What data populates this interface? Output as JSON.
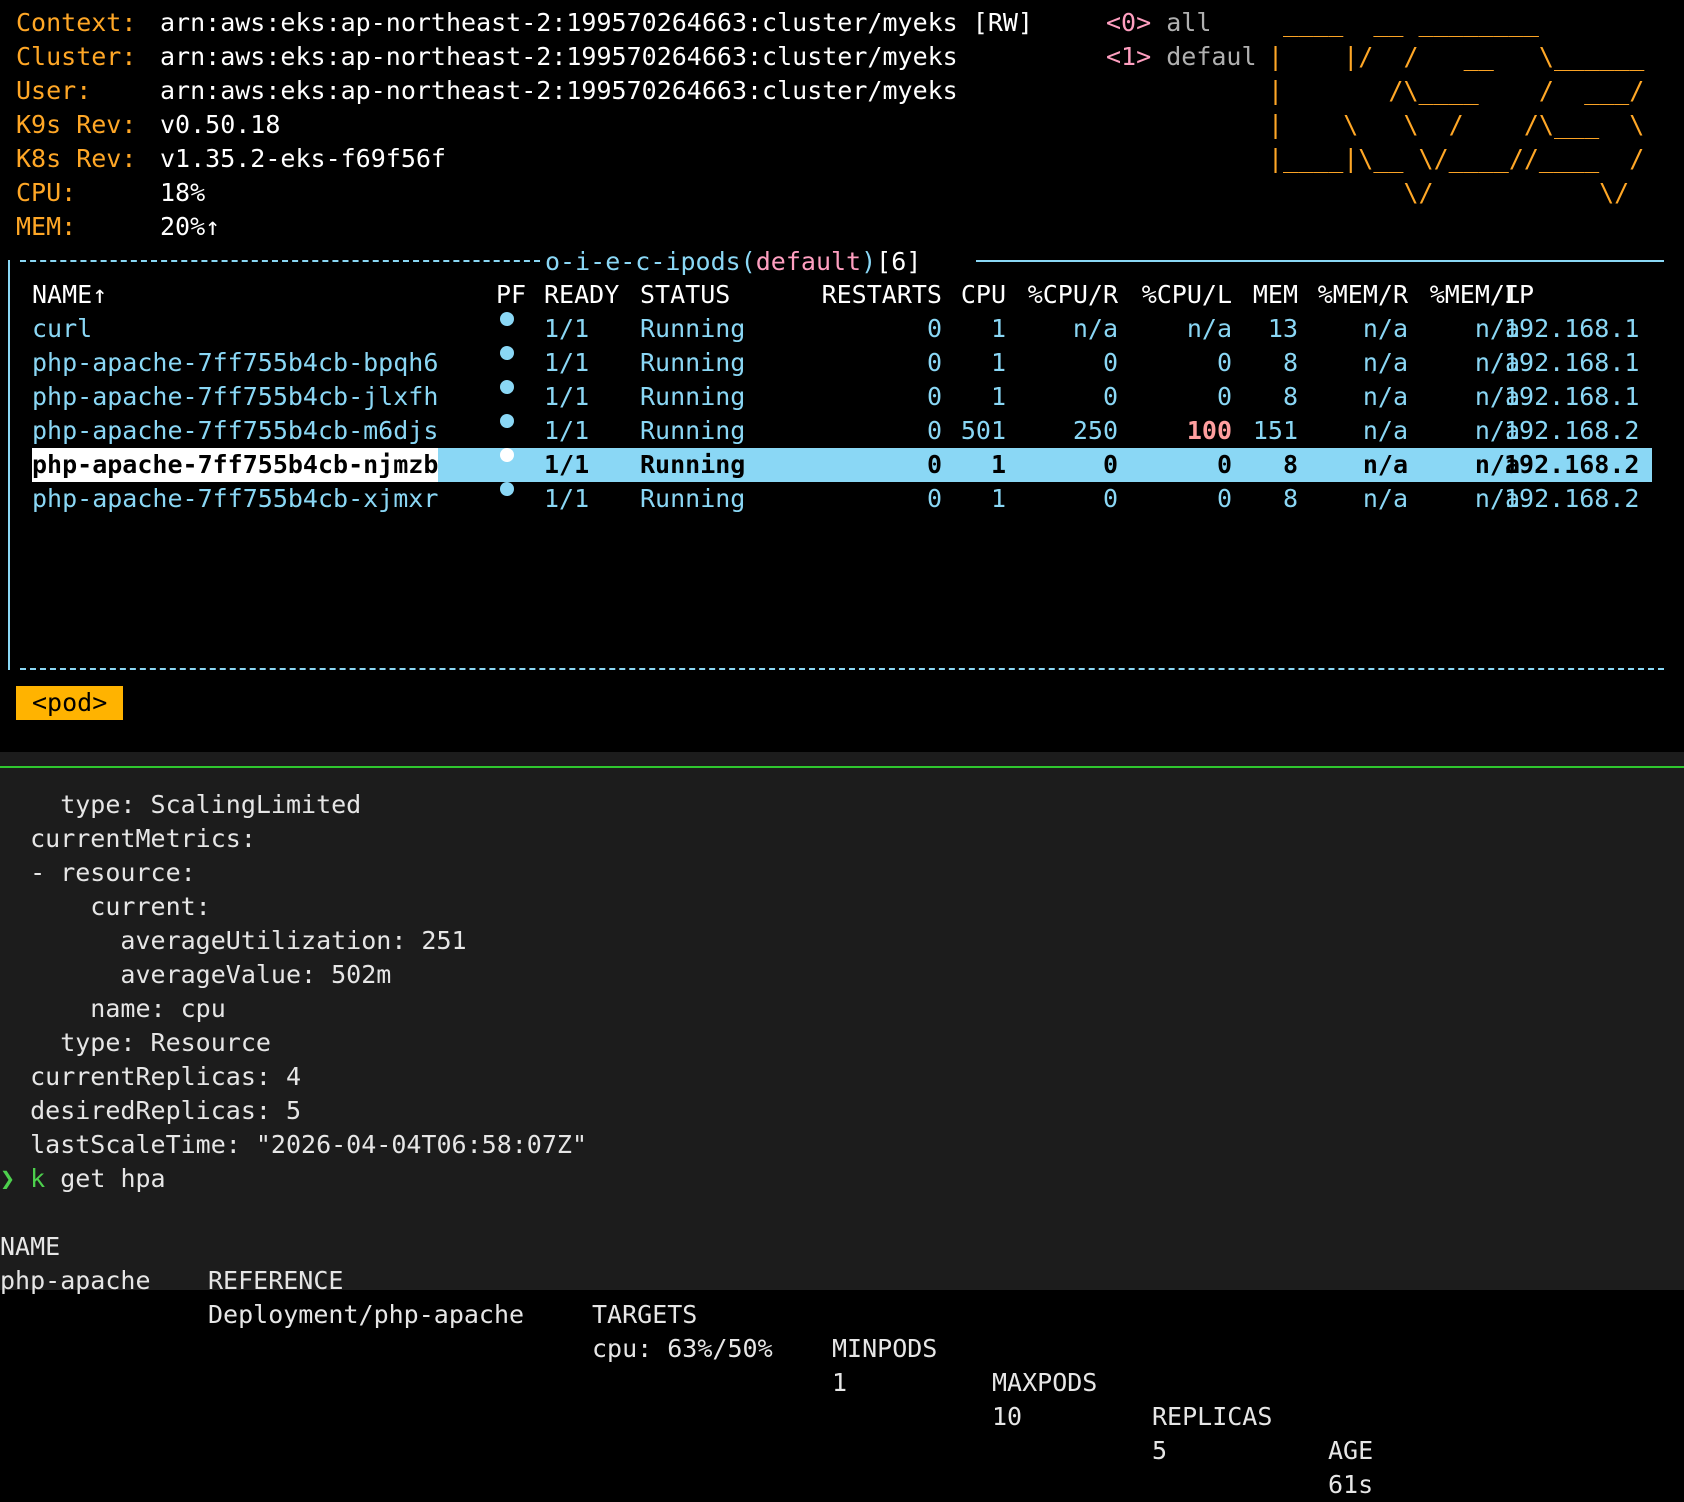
{
  "k9s": {
    "header": {
      "context_label": "Context:",
      "context_value": "arn:aws:eks:ap-northeast-2:199570264663:cluster/myeks",
      "rw": "[RW]",
      "cluster_label": "Cluster:",
      "cluster_value": "arn:aws:eks:ap-northeast-2:199570264663:cluster/myeks",
      "user_label": "User:",
      "user_value": "arn:aws:eks:ap-northeast-2:199570264663:cluster/myeks",
      "k9s_rev_label": "K9s Rev:",
      "k9s_rev_value": "v0.50.18",
      "k8s_rev_label": "K8s Rev:",
      "k8s_rev_value": "v1.35.2-eks-f69f56f",
      "cpu_label": "CPU:",
      "cpu_value": "18%",
      "mem_label": "MEM:",
      "mem_value": "20%↑"
    },
    "namespaces": [
      {
        "key": "<0>",
        "name": "all"
      },
      {
        "key": "<1>",
        "name": "defaul"
      }
    ],
    "logo_lines": [
      " ____  __ ________       ",
      "|    |/  /   __   \\______",
      "|       /\\____    /  ___/",
      "|    \\   \\  /    /\\___  \\",
      "|____|\\__ \\/____//____  /",
      "         \\/           \\/ "
    ],
    "frame_title": {
      "prefix": "o-i-e-c-ipods",
      "ns_open": "(",
      "namespace": "default",
      "ns_close": ")",
      "count": "[6]"
    },
    "columns": [
      "NAME↑",
      "PF",
      "READY",
      "STATUS",
      "RESTARTS",
      "CPU",
      "%CPU/R",
      "%CPU/L",
      "MEM",
      "%MEM/R",
      "%MEM/L",
      "IP"
    ],
    "pods": [
      {
        "name": "curl",
        "ready": "1/1",
        "status": "Running",
        "restarts": "0",
        "cpu": "1",
        "cpu_r": "n/a",
        "cpu_l": "n/a",
        "mem": "13",
        "mem_r": "n/a",
        "mem_l": "n/a",
        "ip": "192.168.1"
      },
      {
        "name": "php-apache-7ff755b4cb-bpqh6",
        "ready": "1/1",
        "status": "Running",
        "restarts": "0",
        "cpu": "1",
        "cpu_r": "0",
        "cpu_l": "0",
        "mem": "8",
        "mem_r": "n/a",
        "mem_l": "n/a",
        "ip": "192.168.1"
      },
      {
        "name": "php-apache-7ff755b4cb-jlxfh",
        "ready": "1/1",
        "status": "Running",
        "restarts": "0",
        "cpu": "1",
        "cpu_r": "0",
        "cpu_l": "0",
        "mem": "8",
        "mem_r": "n/a",
        "mem_l": "n/a",
        "ip": "192.168.1"
      },
      {
        "name": "php-apache-7ff755b4cb-m6djs",
        "ready": "1/1",
        "status": "Running",
        "restarts": "0",
        "cpu": "501",
        "cpu_r": "250",
        "cpu_l": "100",
        "mem": "151",
        "mem_r": "n/a",
        "mem_l": "n/a",
        "ip": "192.168.2"
      },
      {
        "name": "php-apache-7ff755b4cb-njmzb",
        "ready": "1/1",
        "status": "Running",
        "restarts": "0",
        "cpu": "1",
        "cpu_r": "0",
        "cpu_l": "0",
        "mem": "8",
        "mem_r": "n/a",
        "mem_l": "n/a",
        "ip": "192.168.2"
      },
      {
        "name": "php-apache-7ff755b4cb-xjmxr",
        "ready": "1/1",
        "status": "Running",
        "restarts": "0",
        "cpu": "1",
        "cpu_r": "0",
        "cpu_l": "0",
        "mem": "8",
        "mem_r": "n/a",
        "mem_l": "n/a",
        "ip": "192.168.2"
      }
    ],
    "breadcrumb": "<pod>",
    "colors": {
      "accent": "#8ad7f5",
      "label": "#ffa726",
      "breadcrumb": "#ffb300",
      "highlight": "#ff9f9f",
      "divider": "#2fc72f"
    }
  },
  "terminal": {
    "lines": [
      "    type: ScalingLimited",
      "  currentMetrics:",
      "  - resource:",
      "      current:",
      "        averageUtilization: 251",
      "        averageValue: 502m",
      "      name: cpu",
      "    type: Resource",
      "  currentReplicas: 4",
      "  desiredReplicas: 5",
      "  lastScaleTime: \"2026-04-04T06:58:07Z\""
    ],
    "prompt_symbol": "❯",
    "command_k": "k",
    "command_rest": " get hpa",
    "hpa_headers": [
      "NAME",
      "REFERENCE",
      "TARGETS",
      "MINPODS",
      "MAXPODS",
      "REPLICAS",
      "AGE"
    ],
    "hpa_row": [
      "php-apache",
      "Deployment/php-apache",
      "cpu: 63%/50%",
      "1",
      "10",
      "5",
      "61s"
    ]
  }
}
